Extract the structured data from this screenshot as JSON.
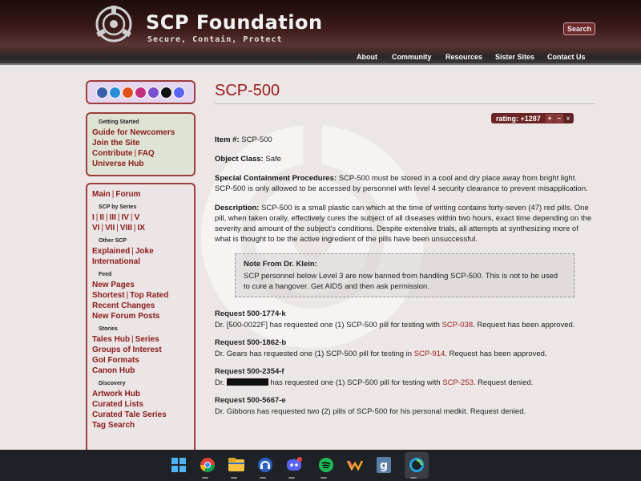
{
  "header": {
    "title": "SCP Foundation",
    "tagline": "Secure, Contain, Protect",
    "search_label": "Search",
    "nav": [
      "About",
      "Community",
      "Resources",
      "Sister Sites",
      "Contact Us"
    ]
  },
  "sidebar": {
    "social_icons": [
      "facebook-icon",
      "twitter-icon",
      "reddit-icon",
      "instagram-icon",
      "twitch-icon",
      "tiktok-icon",
      "discord-icon"
    ],
    "getting_started": {
      "heading": "Getting Started",
      "links": [
        "Guide for Newcomers",
        "Join the Site",
        "Contribute",
        "FAQ",
        "Universe Hub"
      ]
    },
    "main_links": [
      "Main",
      "Forum"
    ],
    "scp_by_series": {
      "heading": "SCP by Series",
      "row1": [
        "I",
        "II",
        "III",
        "IV",
        "V"
      ],
      "row2": [
        "VI",
        "VII",
        "VIII",
        "IX"
      ]
    },
    "other_scp": {
      "heading": "Other SCP",
      "links": [
        "Explained",
        "Joke",
        "International"
      ]
    },
    "feed": {
      "heading": "Feed",
      "links": [
        "New Pages",
        "Shortest",
        "Top Rated",
        "Recent Changes",
        "New Forum Posts"
      ]
    },
    "stories": {
      "heading": "Stories",
      "links": [
        "Tales Hub",
        "Series",
        "Groups of Interest",
        "GoI Formats",
        "Canon Hub"
      ]
    },
    "discovery": {
      "heading": "Discovery",
      "links": [
        "Artwork Hub",
        "Curated Lists",
        "Curated Tale Series",
        "Tag Search"
      ]
    }
  },
  "page": {
    "title": "SCP-500",
    "rating": {
      "label": "rating: +1287",
      "up": "+",
      "down": "–",
      "cancel": "x"
    },
    "item_label": "Item #:",
    "item_value": "SCP-500",
    "class_label": "Object Class:",
    "class_value": "Safe",
    "scp_label": "Special Containment Procedures:",
    "scp_text": "SCP-500 must be stored in a cool and dry place away from bright light. SCP-500 is only allowed to be accessed by personnel with level 4 security clearance to prevent misapplication.",
    "desc_label": "Description:",
    "desc_text": "SCP-500 is a small plastic can which at the time of writing contains forty-seven (47) red pills. One pill, when taken orally, effectively cures the subject of all diseases within two hours, exact time depending on the severity and amount of the subject's conditions. Despite extensive trials, all attempts at synthesizing more of what is thought to be the active ingredient of the pills have been unsuccessful.",
    "note_title": "Note From Dr. Klein:",
    "note_text": "SCP personnel below Level 3 are now banned from handling SCP-500. This is not to be used to cure a hangover. Get AIDS and then ask permission.",
    "requests": [
      {
        "title": "Request 500-1774-k",
        "pre": "Dr. [500-0022F] has requested one (1) SCP-500 pill for testing with ",
        "link": "SCP-038",
        "post": ". Request has been approved."
      },
      {
        "title": "Request 500-1862-b",
        "pre": "Dr. Gears has requested one (1) SCP-500 pill for testing in ",
        "link": "SCP-914",
        "post": ". Request has been approved."
      },
      {
        "title": "Request 500-2354-f",
        "pre": "Dr. ",
        "redacted": true,
        "mid": " has requested one (1) SCP-500 pill for testing with ",
        "link": "SCP-253",
        "post": ". Request denied."
      },
      {
        "title": "Request 500-5667-e",
        "pre": "Dr. Gibbons has requested two (2) pills of SCP-500 for his personal medkit. Request denied.",
        "link": "",
        "post": ""
      }
    ]
  },
  "taskbar": {
    "apps": [
      "windows-start-icon",
      "chrome-icon",
      "file-explorer-icon",
      "headset-app-icon",
      "discord-icon",
      "spotify-icon",
      "winamp-icon",
      "g-app-icon",
      "edge-copilot-icon"
    ]
  },
  "colors": {
    "accent": "#9b1b1b",
    "header_dark": "#2c1414",
    "taskbar": "#1e2226"
  }
}
